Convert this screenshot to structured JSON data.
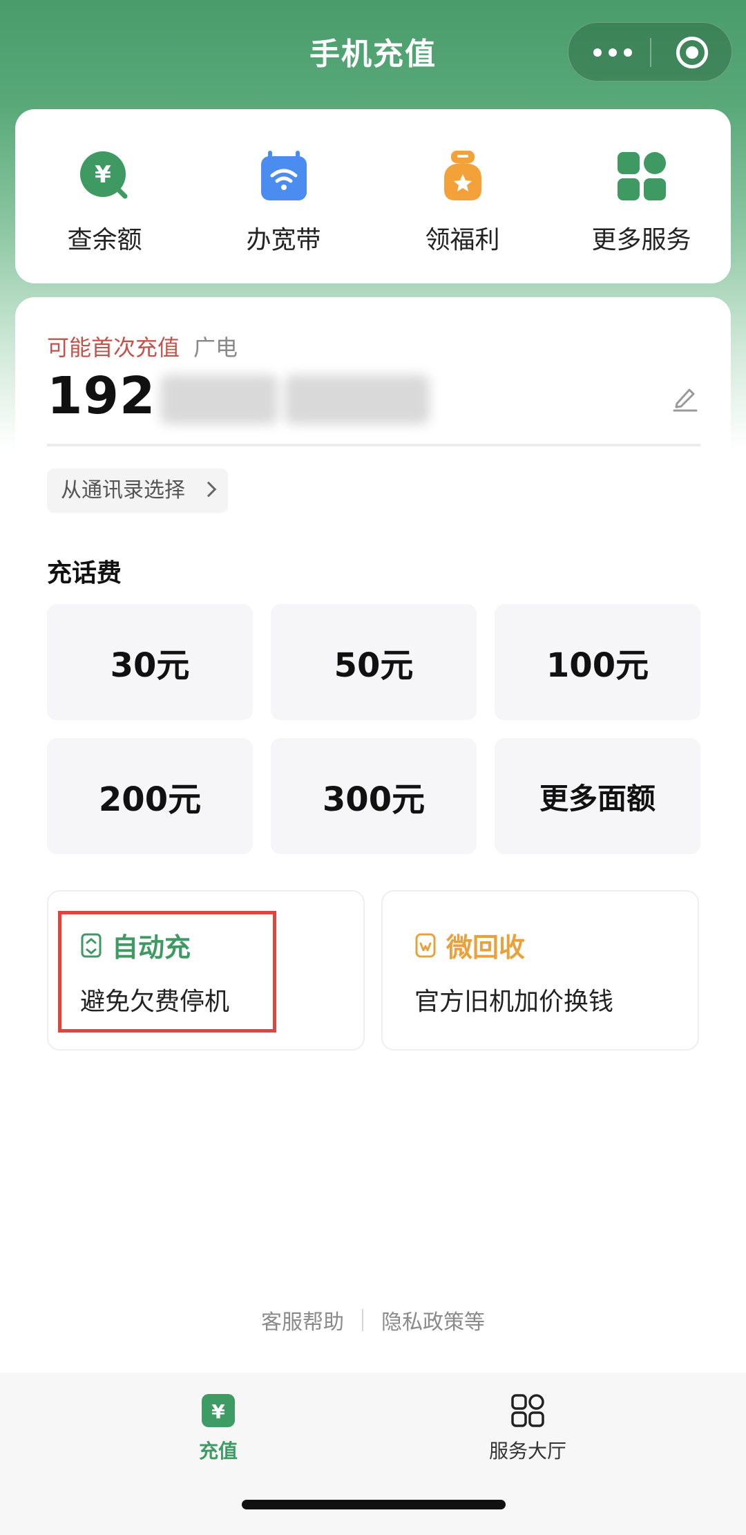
{
  "nav": {
    "title": "手机充值"
  },
  "quick_actions": [
    {
      "label": "查余额",
      "icon": "balance-yuan-icon",
      "color": "#3e9a62"
    },
    {
      "label": "办宽带",
      "icon": "broadband-wifi-icon",
      "color": "#4a8cf0"
    },
    {
      "label": "领福利",
      "icon": "welfare-bag-icon",
      "color": "#f3a23a"
    },
    {
      "label": "更多服务",
      "icon": "grid-icon",
      "color": "#3e9a62"
    }
  ],
  "recharge": {
    "first_tip": "可能首次充值",
    "carrier": "广电",
    "phone_prefix": "192",
    "contacts_label": "从通讯录选择"
  },
  "topup": {
    "title": "充话费",
    "amounts": [
      "30元",
      "50元",
      "100元",
      "200元",
      "300元",
      "更多面额"
    ]
  },
  "promos": {
    "auto": {
      "title": "自动充",
      "desc": "避免欠费停机",
      "color": "#3e9a62"
    },
    "recycle": {
      "title": "微回收",
      "desc": "官方旧机加价换钱",
      "color": "#e9a13b"
    }
  },
  "footer": {
    "help": "客服帮助",
    "privacy": "隐私政策等"
  },
  "tabs": [
    {
      "label": "充值",
      "active": true
    },
    {
      "label": "服务大厅",
      "active": false
    }
  ],
  "colors": {
    "primary": "#3d9b63",
    "highlight": "#e0453d"
  }
}
